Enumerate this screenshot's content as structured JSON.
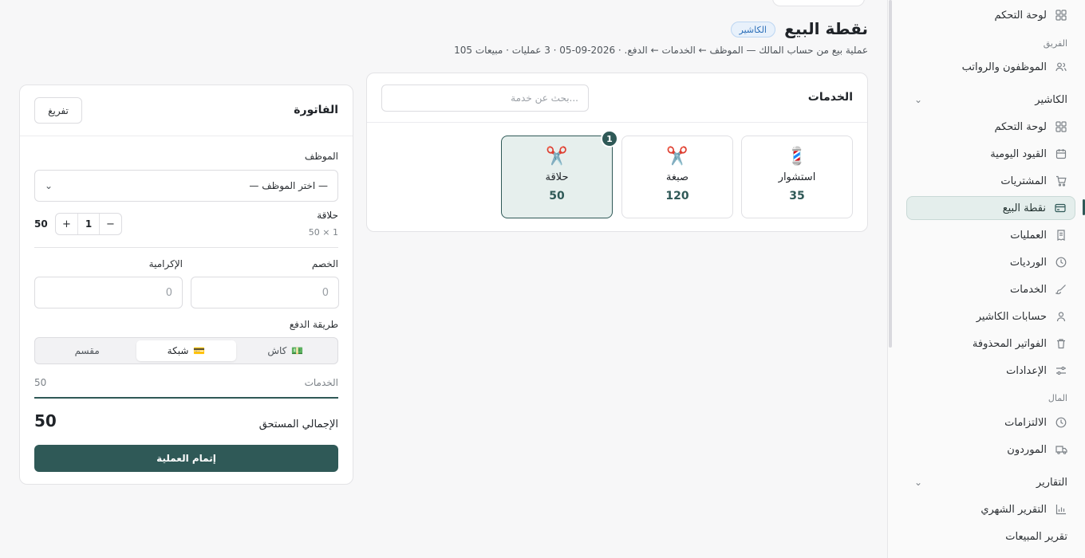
{
  "sidebar": {
    "items": [
      {
        "label": "لوحة التحكم",
        "icon": "dashboard-icon"
      },
      {
        "label": "الموظفون والرواتب",
        "icon": "users-icon"
      },
      {
        "label": "لوحة التحكم",
        "icon": "dashboard-icon"
      },
      {
        "label": "القيود اليومية",
        "icon": "calendar-icon"
      },
      {
        "label": "المشتريات",
        "icon": "cart-icon"
      },
      {
        "label": "نقطة البيع",
        "icon": "card-icon"
      },
      {
        "label": "العمليات",
        "icon": "receipt-icon"
      },
      {
        "label": "الورديات",
        "icon": "clock-icon"
      },
      {
        "label": "الخدمات",
        "icon": "brush-icon"
      },
      {
        "label": "حسابات الكاشير",
        "icon": "user-icon"
      },
      {
        "label": "الفواتير المحذوفة",
        "icon": "trash-icon"
      },
      {
        "label": "الإعدادات",
        "icon": "sliders-icon"
      },
      {
        "label": "الالتزامات",
        "icon": "clock-icon"
      },
      {
        "label": "الموردون",
        "icon": "truck-icon"
      },
      {
        "label": "التقرير الشهري",
        "icon": "chart-icon"
      },
      {
        "label": "تقرير المبيعات",
        "icon": "none"
      }
    ],
    "sections": {
      "team": "الفريق",
      "money": "المال"
    },
    "groups": {
      "cashier": "الكاشير",
      "reports": "التقارير"
    }
  },
  "header": {
    "title": "نقطة البيع",
    "badge": "الكاشير",
    "subtitle": "عملية بيع من حساب المالك — الموظف ← الخدمات ← الدفع. · 2026-09-05 · 3 عمليات · مبيعات 105"
  },
  "services": {
    "title": "الخدمات",
    "search_placeholder": "بحث عن خدمة...",
    "items": [
      {
        "name": "استشوار",
        "price": "35",
        "icon": "💈"
      },
      {
        "name": "صبغة",
        "price": "120",
        "icon": "✂️"
      },
      {
        "name": "حلاقة",
        "price": "50",
        "icon": "✂️",
        "count": "1"
      }
    ]
  },
  "invoice": {
    "title": "الفاتورة",
    "clear_label": "تفريغ",
    "employee_label": "الموظف",
    "employee_value": "— اختر الموظف —",
    "line": {
      "name": "حلاقة",
      "sub": "50 × 1",
      "qty": "1",
      "total": "50",
      "minus": "−",
      "plus": "+"
    },
    "discount_label": "الخصم",
    "discount_value": "0",
    "tip_label": "الإكرامية",
    "tip_value": "0",
    "payment_label": "طريقة الدفع",
    "payment_options": [
      {
        "label": "كاش",
        "icon": "💵"
      },
      {
        "label": "شبكة",
        "icon": "💳"
      },
      {
        "label": "مقسم",
        "icon": ""
      }
    ],
    "services_label": "الخدمات",
    "services_value": "50",
    "total_label": "الإجمالي المستحق",
    "total_value": "50",
    "complete_label": "إتمام العملية"
  },
  "colors": {
    "accent": "#2f5957",
    "badge": "#2c6fb8"
  }
}
